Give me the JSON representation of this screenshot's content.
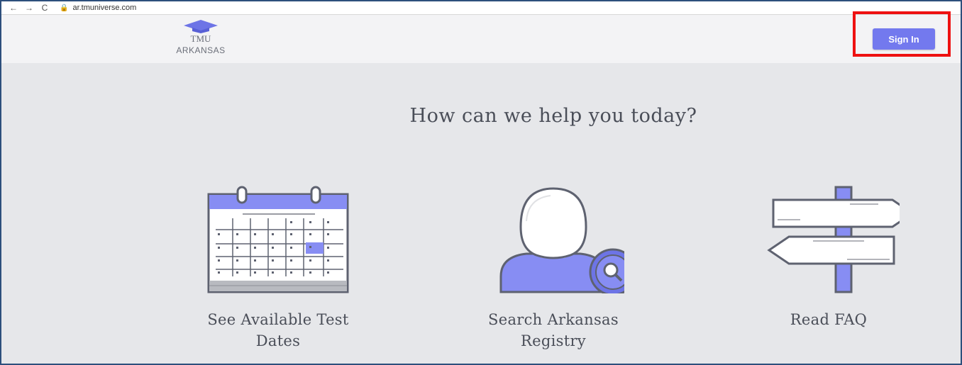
{
  "browser": {
    "url": "ar.tmuniverse.com",
    "back_icon": "←",
    "forward_icon": "→",
    "reload_icon": "C",
    "lock_icon": "🔒"
  },
  "header": {
    "logo_line1": "TMU",
    "logo_line2": "ARKANSAS",
    "signin_label": "Sign In"
  },
  "main": {
    "headline": "How can we help you today?",
    "cards": [
      {
        "label": "See Available Test Dates",
        "icon": "calendar-icon"
      },
      {
        "label": "Search Arkansas Registry",
        "icon": "person-search-icon"
      },
      {
        "label": "Read FAQ",
        "icon": "signpost-icon"
      }
    ]
  },
  "colors": {
    "accent": "#7379ee",
    "highlight": "#ee1111",
    "page_bg": "#e6e7ea",
    "header_bg": "#f3f3f5",
    "text": "#4a4e58"
  }
}
